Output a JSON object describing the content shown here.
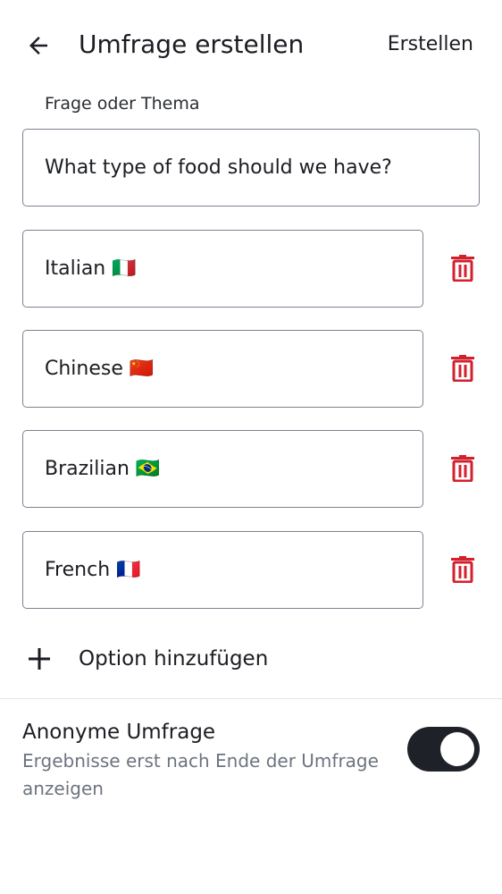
{
  "header": {
    "title": "Umfrage erstellen",
    "create_label": "Erstellen",
    "back_icon": "arrow-left-icon"
  },
  "question": {
    "label": "Frage oder Thema",
    "value": "What type of food should we have?"
  },
  "options": [
    {
      "value": "Italian 🇮🇹"
    },
    {
      "value": "Chinese 🇨🇳"
    },
    {
      "value": "Brazilian 🇧🇷"
    },
    {
      "value": "French 🇫🇷"
    }
  ],
  "delete_icon": "trash-icon",
  "delete_color": "#d3202d",
  "add_option": {
    "label": "Option hinzufügen",
    "icon": "plus-icon"
  },
  "anonymous": {
    "title": "Anonyme Umfrage",
    "description": "Ergebnisse erst nach Ende der Umfrage anzeigen",
    "enabled": true
  }
}
